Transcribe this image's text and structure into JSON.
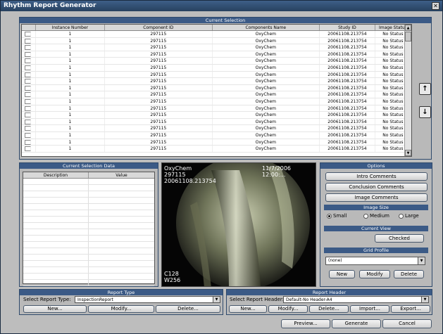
{
  "window": {
    "title": "Rhythm Report Generator",
    "close_glyph": "✕"
  },
  "current_selection": {
    "title": "Current Selection",
    "columns": [
      "",
      "Instance Number",
      "Component ID",
      "Components Name",
      "Study ID",
      "Image Status"
    ],
    "rows": [
      [
        "1",
        "297115",
        "OxyChem",
        "20061108.213754",
        "No Status"
      ],
      [
        "1",
        "297115",
        "OxyChem",
        "20061108.213754",
        "No Status"
      ],
      [
        "1",
        "297115",
        "OxyChem",
        "20061108.213754",
        "No Status"
      ],
      [
        "1",
        "297115",
        "OxyChem",
        "20061108.213754",
        "No Status"
      ],
      [
        "1",
        "297115",
        "OxyChem",
        "20061108.213754",
        "No Status"
      ],
      [
        "1",
        "297115",
        "OxyChem",
        "20061108.213754",
        "No Status"
      ],
      [
        "1",
        "297115",
        "OxyChem",
        "20061108.213754",
        "No Status"
      ],
      [
        "1",
        "297115",
        "OxyChem",
        "20061108.213754",
        "No Status"
      ],
      [
        "1",
        "297115",
        "OxyChem",
        "20061108.213754",
        "No Status"
      ],
      [
        "1",
        "297115",
        "OxyChem",
        "20061108.213754",
        "No Status"
      ],
      [
        "1",
        "297115",
        "OxyChem",
        "20061108.213754",
        "No Status"
      ],
      [
        "1",
        "297115",
        "OxyChem",
        "20061108.213754",
        "No Status"
      ],
      [
        "1",
        "297115",
        "OxyChem",
        "20061108.213754",
        "No Status"
      ],
      [
        "1",
        "297115",
        "OxyChem",
        "20061108.213754",
        "No Status"
      ],
      [
        "1",
        "297115",
        "OxyChem",
        "20061108.213754",
        "No Status"
      ],
      [
        "1",
        "297115",
        "OxyChem",
        "20061108.213754",
        "No Status"
      ],
      [
        "1",
        "297115",
        "OxyChem",
        "20061108.213754",
        "No Status"
      ],
      [
        "1",
        "297115",
        "OxyChem",
        "20061108.213754",
        "No Status"
      ]
    ],
    "move_up_icon": "↑",
    "move_down_icon": "↓"
  },
  "selection_data": {
    "title": "Current Selection Data",
    "columns": [
      "Description",
      "Value"
    ]
  },
  "viewer": {
    "component": "OxyChem",
    "id": "297115",
    "study": "20061108.213754",
    "datetime": "11/7/2006 12:00:...",
    "c_value": "C128",
    "w_value": "W256"
  },
  "options": {
    "title": "Options",
    "intro": "Intro Comments",
    "conclusion": "Conclusion Comments",
    "image_comments": "Image Comments",
    "image_size_title": "Image Size",
    "size_small": "Small",
    "size_medium": "Medium",
    "size_large": "Large",
    "current_view_title": "Current View",
    "checked": "Checked",
    "grid_profile_title": "Grid Profile",
    "grid_value": "(none)",
    "new": "New",
    "modify": "Modify",
    "delete": "Delete"
  },
  "report_type": {
    "title": "Report Type",
    "label": "Select Report Type:",
    "value": "InspectionReport",
    "new": "New...",
    "modify": "Modify...",
    "delete": "Delete..."
  },
  "report_header": {
    "title": "Report Header",
    "label": "Select Report Header:",
    "value": "Default-No Header-A4",
    "new": "New...",
    "modify": "Modify...",
    "delete": "Delete...",
    "import": "Import...",
    "export": "Export..."
  },
  "footer": {
    "preview": "Preview...",
    "generate": "Generate",
    "cancel": "Cancel"
  }
}
